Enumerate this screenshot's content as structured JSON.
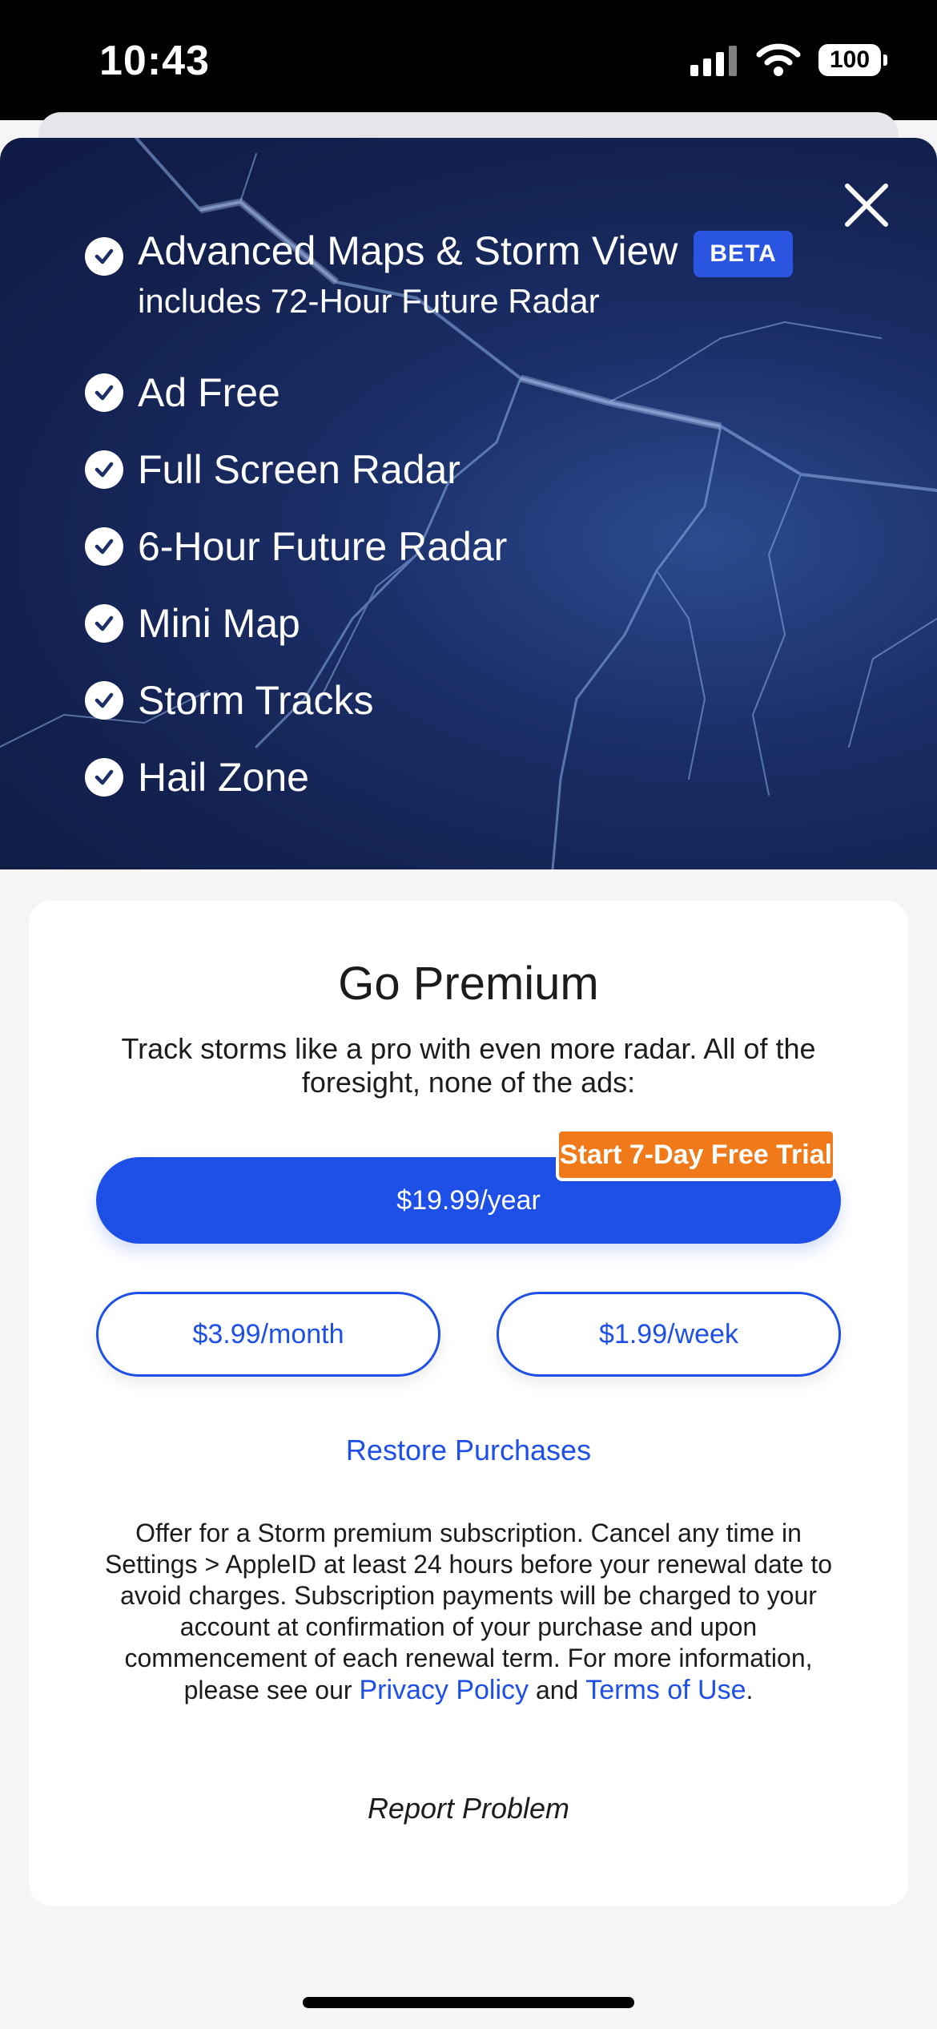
{
  "status": {
    "time": "10:43",
    "battery": "100"
  },
  "features": [
    {
      "label": "Advanced Maps & Storm View",
      "badge": "BETA",
      "sub": "includes 72-Hour Future Radar"
    },
    {
      "label": "Ad Free"
    },
    {
      "label": "Full Screen Radar"
    },
    {
      "label": "6-Hour Future Radar"
    },
    {
      "label": "Mini Map"
    },
    {
      "label": "Storm Tracks"
    },
    {
      "label": "Hail Zone"
    }
  ],
  "card": {
    "title": "Go Premium",
    "subtitle": "Track storms like a pro with even more radar. All of the foresight, none of the ads:",
    "trial_badge": "Start 7-Day Free Trial",
    "year_price": "$19.99/year",
    "month_price": "$3.99/month",
    "week_price": "$1.99/week",
    "restore": "Restore Purchases",
    "legal_text": "Offer for a Storm premium subscription. Cancel any time in Settings > AppleID at least 24 hours before your renewal date to avoid charges. Subscription payments will be charged to your account at confirmation of your purchase and upon commencement of each renewal term. For more information, please see our ",
    "privacy_link": "Privacy Policy",
    "and_text": " and ",
    "terms_link": "Terms of Use",
    "period": ".",
    "report": "Report Problem"
  },
  "colors": {
    "accent": "#1e4fe6",
    "trial": "#f07a1a",
    "hero": "#1b2f68"
  }
}
